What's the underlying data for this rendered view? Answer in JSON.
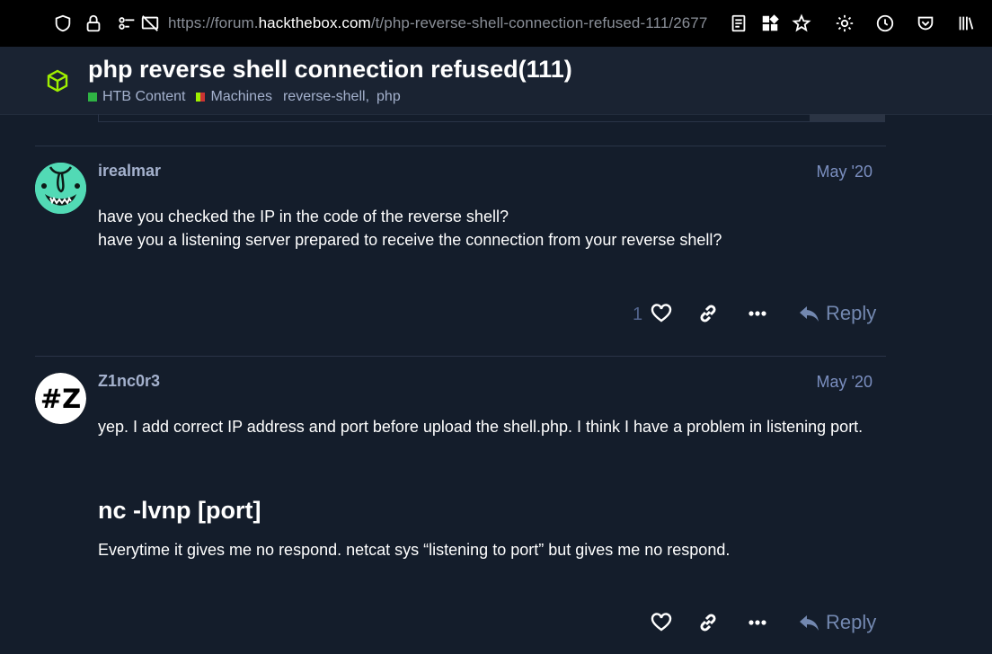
{
  "browser": {
    "url_prefix": "https://forum.",
    "url_domain": "hackthebox.com",
    "url_path": "/t/php-reverse-shell-connection-refused-111/2677"
  },
  "topic": {
    "title": "php reverse shell connection refused(111)",
    "category_1": "HTB Content",
    "category_2": "Machines",
    "tag_1": "reverse-shell",
    "tag_sep": ",",
    "tag_2": "php",
    "colors": {
      "category_1": "#2fb344",
      "category_2": "split",
      "accent_icon": "#9fef00"
    }
  },
  "posts": [
    {
      "username": "irealmar",
      "date": "May '20",
      "line_1": "have you checked the IP in the code of the reverse shell?",
      "line_2": "have you a listening server prepared to receive the connection from your reverse shell?",
      "likes": "1",
      "reply_label": "Reply",
      "avatar_icon": "cartoon-face-avatar"
    },
    {
      "username": "Z1nc0r3",
      "date": "May '20",
      "paragraph_1": "yep. I add correct IP address and port before upload the shell.php. I think I have a problem in listening port.",
      "heading": "nc -lvnp [port]",
      "paragraph_2": "Everytime it gives me no respond. netcat sys “listening to port” but gives me no respond.",
      "avatar_text": "#Z",
      "reply_label": "Reply"
    }
  ]
}
